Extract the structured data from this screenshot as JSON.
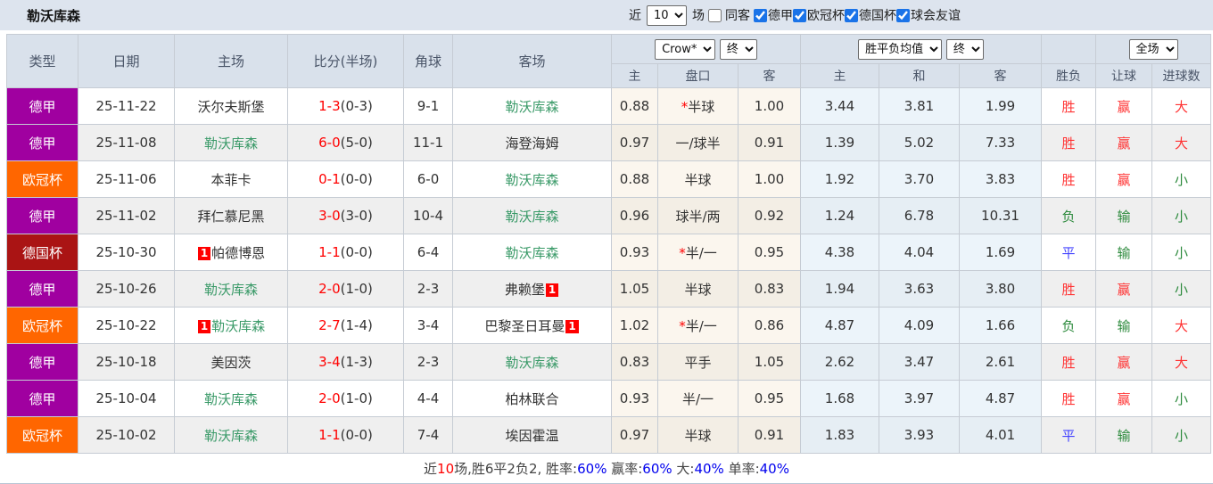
{
  "topbar": {
    "title": "勒沃库森",
    "recent_label": "近",
    "recent_value": "10",
    "unit_label": "场",
    "same_venue": {
      "label": "同客",
      "checked": false
    },
    "filters": [
      {
        "label": "德甲",
        "checked": true
      },
      {
        "label": "欧冠杯",
        "checked": true
      },
      {
        "label": "德国杯",
        "checked": true
      },
      {
        "label": "球会友谊",
        "checked": true
      }
    ]
  },
  "table_header": {
    "cols": [
      "类型",
      "日期",
      "主场",
      "比分(半场)",
      "角球",
      "客场"
    ],
    "odds_source": "Crow*",
    "odds_stage": "终",
    "avg_source": "胜平负均值",
    "avg_stage": "终",
    "scope": "全场",
    "sub_cols": [
      "主",
      "盘口",
      "客",
      "主",
      "和",
      "客",
      "胜负",
      "让球",
      "进球数"
    ]
  },
  "league_colors": {
    "德甲": "#a000a0",
    "欧冠杯": "#ff6600",
    "德国杯": "#aa1414"
  },
  "result_palette": {
    "red": "c-red",
    "green": "c-green",
    "blue": "c-blue"
  },
  "rows": [
    {
      "league": "德甲",
      "date": "25-11-22",
      "home": {
        "name": "沃尔夫斯堡"
      },
      "score": "1-3",
      "half": "(0-3)",
      "corner": "9-1",
      "away": {
        "name": "勒沃库森",
        "self": true
      },
      "odds": [
        "0.88",
        "*半球",
        "1.00"
      ],
      "avg": [
        "3.44",
        "3.81",
        "1.99"
      ],
      "result": [
        "胜",
        "赢",
        "大"
      ],
      "result_colors": [
        "red",
        "red",
        "red"
      ]
    },
    {
      "league": "德甲",
      "date": "25-11-08",
      "home": {
        "name": "勒沃库森",
        "self": true
      },
      "score": "6-0",
      "half": "(5-0)",
      "corner": "11-1",
      "away": {
        "name": "海登海姆"
      },
      "odds": [
        "0.97",
        "一/球半",
        "0.91"
      ],
      "avg": [
        "1.39",
        "5.02",
        "7.33"
      ],
      "result": [
        "胜",
        "赢",
        "大"
      ],
      "result_colors": [
        "red",
        "red",
        "red"
      ]
    },
    {
      "league": "欧冠杯",
      "date": "25-11-06",
      "home": {
        "name": "本菲卡"
      },
      "score": "0-1",
      "half": "(0-0)",
      "corner": "6-0",
      "away": {
        "name": "勒沃库森",
        "self": true
      },
      "odds": [
        "0.88",
        "半球",
        "1.00"
      ],
      "avg": [
        "1.92",
        "3.70",
        "3.83"
      ],
      "result": [
        "胜",
        "赢",
        "小"
      ],
      "result_colors": [
        "red",
        "red",
        "green"
      ]
    },
    {
      "league": "德甲",
      "date": "25-11-02",
      "home": {
        "name": "拜仁慕尼黑"
      },
      "score": "3-0",
      "half": "(3-0)",
      "corner": "10-4",
      "away": {
        "name": "勒沃库森",
        "self": true
      },
      "odds": [
        "0.96",
        "球半/两",
        "0.92"
      ],
      "avg": [
        "1.24",
        "6.78",
        "10.31"
      ],
      "result": [
        "负",
        "输",
        "小"
      ],
      "result_colors": [
        "green",
        "green",
        "green"
      ]
    },
    {
      "league": "德国杯",
      "date": "25-10-30",
      "home": {
        "name": "帕德博恩",
        "badge": "1",
        "badge_pos": "before"
      },
      "score": "1-1",
      "half": "(0-0)",
      "corner": "6-4",
      "away": {
        "name": "勒沃库森",
        "self": true
      },
      "odds": [
        "0.93",
        "*半/一",
        "0.95"
      ],
      "avg": [
        "4.38",
        "4.04",
        "1.69"
      ],
      "result": [
        "平",
        "输",
        "小"
      ],
      "result_colors": [
        "blue",
        "green",
        "green"
      ]
    },
    {
      "league": "德甲",
      "date": "25-10-26",
      "home": {
        "name": "勒沃库森",
        "self": true
      },
      "score": "2-0",
      "half": "(1-0)",
      "corner": "2-3",
      "away": {
        "name": "弗赖堡",
        "badge": "1",
        "badge_pos": "after"
      },
      "odds": [
        "1.05",
        "半球",
        "0.83"
      ],
      "avg": [
        "1.94",
        "3.63",
        "3.80"
      ],
      "result": [
        "胜",
        "赢",
        "小"
      ],
      "result_colors": [
        "red",
        "red",
        "green"
      ]
    },
    {
      "league": "欧冠杯",
      "date": "25-10-22",
      "home": {
        "name": "勒沃库森",
        "self": true,
        "badge": "1",
        "badge_pos": "before"
      },
      "score": "2-7",
      "half": "(1-4)",
      "corner": "3-4",
      "away": {
        "name": "巴黎圣日耳曼",
        "badge": "1",
        "badge_pos": "after"
      },
      "odds": [
        "1.02",
        "*半/一",
        "0.86"
      ],
      "avg": [
        "4.87",
        "4.09",
        "1.66"
      ],
      "result": [
        "负",
        "输",
        "大"
      ],
      "result_colors": [
        "green",
        "green",
        "red"
      ]
    },
    {
      "league": "德甲",
      "date": "25-10-18",
      "home": {
        "name": "美因茨"
      },
      "score": "3-4",
      "half": "(1-3)",
      "corner": "2-3",
      "away": {
        "name": "勒沃库森",
        "self": true
      },
      "odds": [
        "0.83",
        "平手",
        "1.05"
      ],
      "avg": [
        "2.62",
        "3.47",
        "2.61"
      ],
      "result": [
        "胜",
        "赢",
        "大"
      ],
      "result_colors": [
        "red",
        "red",
        "red"
      ]
    },
    {
      "league": "德甲",
      "date": "25-10-04",
      "home": {
        "name": "勒沃库森",
        "self": true
      },
      "score": "2-0",
      "half": "(1-0)",
      "corner": "4-4",
      "away": {
        "name": "柏林联合"
      },
      "odds": [
        "0.93",
        "半/一",
        "0.95"
      ],
      "avg": [
        "1.68",
        "3.97",
        "4.87"
      ],
      "result": [
        "胜",
        "赢",
        "小"
      ],
      "result_colors": [
        "red",
        "red",
        "green"
      ]
    },
    {
      "league": "欧冠杯",
      "date": "25-10-02",
      "home": {
        "name": "勒沃库森",
        "self": true
      },
      "score": "1-1",
      "half": "(0-0)",
      "corner": "7-4",
      "away": {
        "name": "埃因霍温"
      },
      "odds": [
        "0.97",
        "半球",
        "0.91"
      ],
      "avg": [
        "1.83",
        "3.93",
        "4.01"
      ],
      "result": [
        "平",
        "输",
        "小"
      ],
      "result_colors": [
        "blue",
        "green",
        "green"
      ]
    }
  ],
  "footer": {
    "segments": [
      {
        "text": "近",
        "color": "dark"
      },
      {
        "text": "10",
        "color": "red"
      },
      {
        "text": "场,胜6平2负2, 胜率:",
        "color": "dark"
      },
      {
        "text": "60%",
        "color": "blue"
      },
      {
        "text": " 赢率:",
        "color": "dark"
      },
      {
        "text": "60%",
        "color": "blue"
      },
      {
        "text": " 大:",
        "color": "dark"
      },
      {
        "text": "40%",
        "color": "blue"
      },
      {
        "text": " 单率:",
        "color": "dark"
      },
      {
        "text": "40%",
        "color": "blue"
      }
    ]
  }
}
